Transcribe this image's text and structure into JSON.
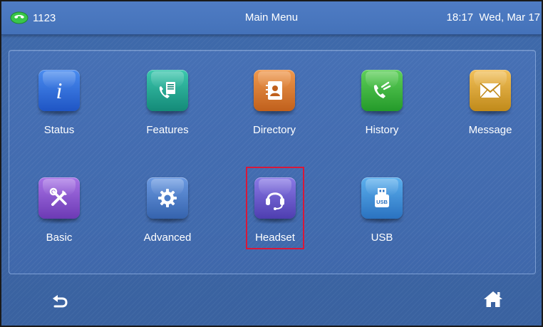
{
  "status_bar": {
    "line_number": "1123",
    "title": "Main Menu",
    "time": "18:17",
    "date": "Wed, Mar 17",
    "phone_icon": "phone-handset-icon"
  },
  "menu": {
    "items": [
      {
        "label": "Status",
        "icon": "info-icon",
        "color": "#2b66d6"
      },
      {
        "label": "Features",
        "icon": "phone-document-icon",
        "color": "#21a38f"
      },
      {
        "label": "Directory",
        "icon": "address-book-icon",
        "color": "#d97a2e"
      },
      {
        "label": "History",
        "icon": "call-log-icon",
        "color": "#3aa83a"
      },
      {
        "label": "Message",
        "icon": "envelope-icon",
        "color": "#d9a532"
      },
      {
        "label": "Basic",
        "icon": "tools-icon",
        "color": "#8a52c8"
      },
      {
        "label": "Advanced",
        "icon": "gear-icon",
        "color": "#4a7dc9"
      },
      {
        "label": "Headset",
        "icon": "headset-icon",
        "color": "#6d5cd0"
      },
      {
        "label": "USB",
        "icon": "usb-icon",
        "color": "#3a8ad0"
      }
    ],
    "highlighted": "Headset",
    "highlight_color": "#d8183a"
  },
  "softkeys": {
    "back_icon": "back-arrow-icon",
    "home_icon": "home-icon"
  }
}
